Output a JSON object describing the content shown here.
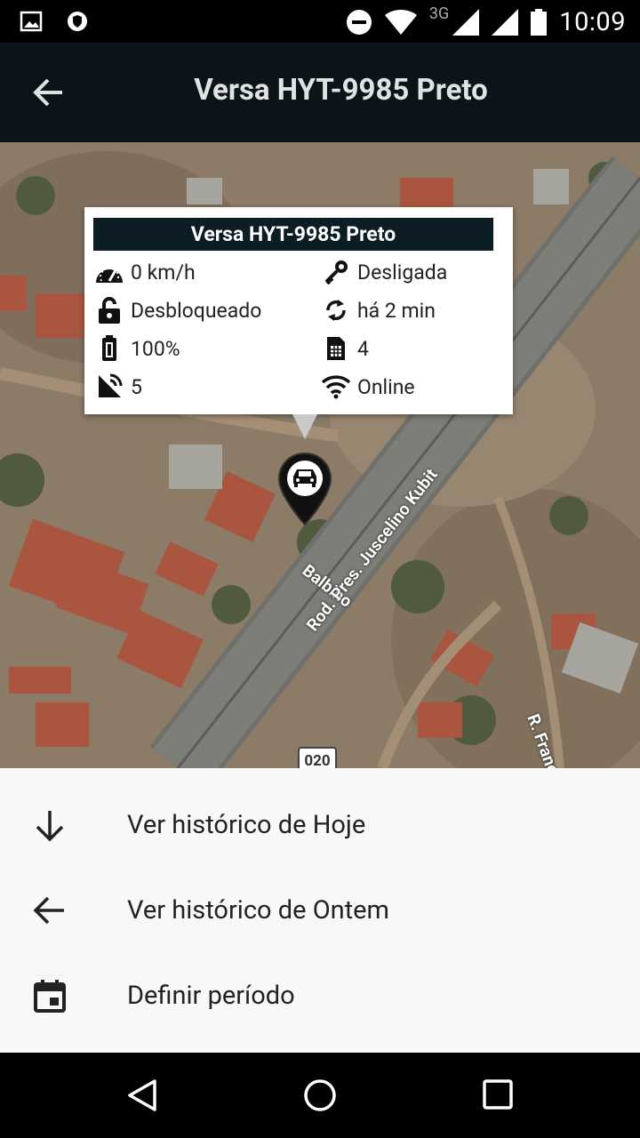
{
  "status_bar": {
    "time": "10:09",
    "network": "3G",
    "icons": [
      "image-icon",
      "shield-icon",
      "do-not-disturb-icon",
      "wifi-icon",
      "signal-icon",
      "signal-icon",
      "battery-icon"
    ]
  },
  "app_bar": {
    "title": "Versa HYT-9985 Preto",
    "back_icon": "arrow-left-icon"
  },
  "map": {
    "road_labels": {
      "rodovia": "Rod. Pres. Juscelino Kubit",
      "rua": "R. Francisco Firmino",
      "balbino": "Balbino"
    },
    "shield_number": "020",
    "marker_icon": "car-marker-icon"
  },
  "info_window": {
    "title": "Versa HYT-9985 Preto",
    "speed": "0 km/h",
    "ignition": "Desligada",
    "lock": "Desbloqueado",
    "last_update": "há 2 min",
    "battery": "100%",
    "sim": "4",
    "satellites": "5",
    "connection": "Online"
  },
  "sheet": {
    "items": [
      {
        "label": "Ver histórico de Hoje",
        "icon": "arrow-down-icon"
      },
      {
        "label": "Ver histórico de Ontem",
        "icon": "arrow-left-icon"
      },
      {
        "label": "Definir período",
        "icon": "calendar-icon"
      }
    ]
  },
  "nav_bar": {
    "buttons": [
      "back-triangle-icon",
      "home-circle-icon",
      "recents-square-icon"
    ]
  },
  "colors": {
    "app_bar": "#0b1519",
    "info_header": "#0c1d24",
    "sheet_bg": "#f8f8f8"
  }
}
